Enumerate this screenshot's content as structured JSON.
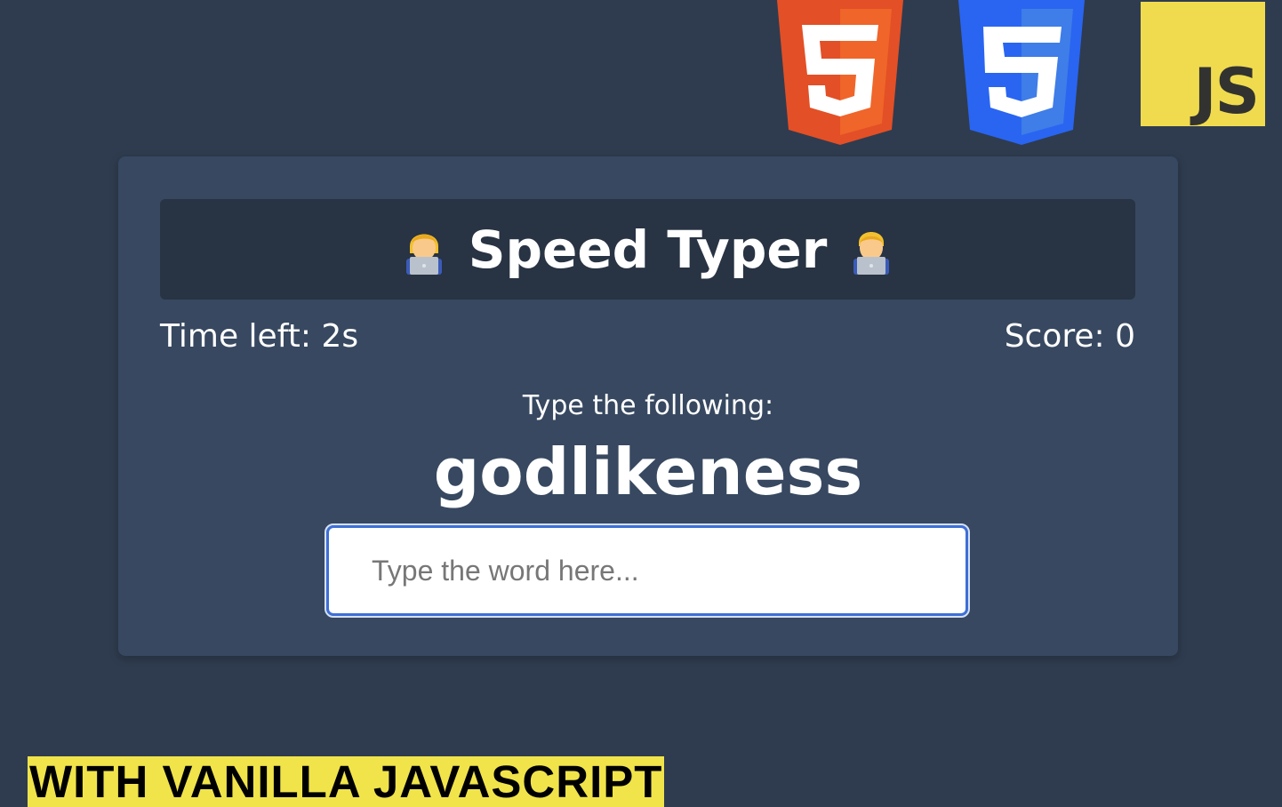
{
  "logos": {
    "html5_icon": "html5-shield",
    "css3_icon": "css3-shield",
    "js_label": "JS"
  },
  "app": {
    "title": "Speed Typer",
    "title_icon": "person-with-laptop-emoji"
  },
  "stats": {
    "time_left": "Time left: 2s",
    "score": "Score: 0"
  },
  "game": {
    "prompt": "Type the following:",
    "current_word": "godlikeness"
  },
  "input": {
    "placeholder": "Type the word here...",
    "value": ""
  },
  "banner": {
    "text": "WITH VANILLA JAVASCRIPT"
  },
  "colors": {
    "page_bg": "#2f3c4f",
    "card_bg": "#374860",
    "header_bg": "#283343",
    "input_border": "#3e6fd6",
    "banner_bg": "#f0e44a",
    "html5": "#e34f26",
    "css3": "#2965f1",
    "js": "#f0db4f"
  }
}
